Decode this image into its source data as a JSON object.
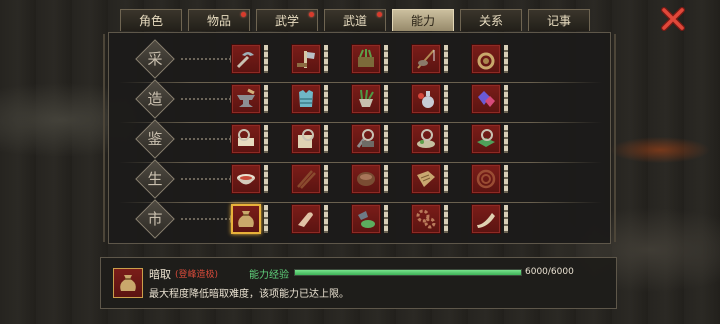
{
  "tabs": [
    {
      "label": "角色",
      "active": false,
      "badge": false
    },
    {
      "label": "物品",
      "active": false,
      "badge": true
    },
    {
      "label": "武学",
      "active": false,
      "badge": true
    },
    {
      "label": "武道",
      "active": false,
      "badge": true
    },
    {
      "label": "能力",
      "active": true,
      "badge": false
    },
    {
      "label": "关系",
      "active": false,
      "badge": false
    },
    {
      "label": "记事",
      "active": false,
      "badge": false
    }
  ],
  "rows": [
    {
      "label": "采",
      "icons": [
        "pickaxe-icon",
        "axe-icon",
        "herb-basket-icon",
        "fishing-rod-icon",
        "rope-icon"
      ]
    },
    {
      "label": "造",
      "icons": [
        "anvil-icon",
        "armor-icon",
        "herb-mortar-icon",
        "alchemy-icon",
        "gem-icon"
      ]
    },
    {
      "label": "鉴",
      "icons": [
        "scroll-inspect-icon",
        "book-inspect-icon",
        "weapon-inspect-icon",
        "medicine-inspect-icon",
        "jade-inspect-icon"
      ]
    },
    {
      "label": "生",
      "icons": [
        "bowl-icon",
        "chopsticks-icon",
        "pot-icon",
        "map-icon",
        "whip-icon"
      ]
    },
    {
      "label": "市",
      "icons": [
        "money-bag-icon",
        "hand-icon",
        "tea-icon",
        "gears-icon",
        "horn-icon"
      ]
    }
  ],
  "info": {
    "skill_name": "暗取",
    "skill_tag": "(登峰造极)",
    "exp_label": "能力经验",
    "exp_value": "6000/6000",
    "exp_progress": 1.0,
    "description": "最大程度降低暗取难度，该项能力已达上限。",
    "icon": "money-bag-icon"
  },
  "colors": {
    "icon_bg": "#6b1814",
    "exp_fill": "#4fc268",
    "active_tab": "#b8ab8a",
    "selected_border": "#e9b23a"
  }
}
